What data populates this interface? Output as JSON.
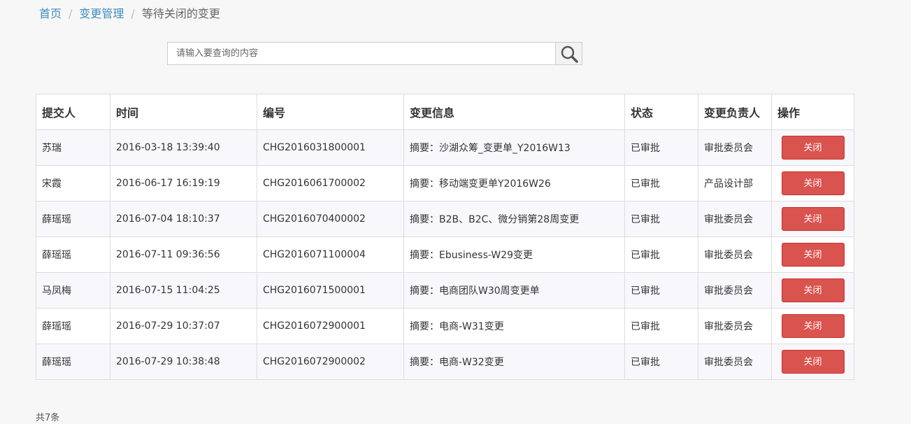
{
  "breadcrumb": {
    "home": "首页",
    "parent": "变更管理",
    "current": "等待关闭的变更",
    "separator": "/"
  },
  "search": {
    "placeholder": "请输入要查询的内容",
    "value": "",
    "button_icon": "search-icon"
  },
  "table": {
    "headers": [
      "提交人",
      "时间",
      "编号",
      "变更信息",
      "状态",
      "变更负责人",
      "操作"
    ],
    "rows": [
      {
        "submitter": "苏瑞",
        "time": "2016-03-18 13:39:40",
        "code": "CHG2016031800001",
        "info": "摘要：沙湖众筹_变更单_Y2016W13",
        "status": "已审批",
        "owner": "审批委员会",
        "action": "关闭"
      },
      {
        "submitter": "宋霞",
        "time": "2016-06-17 16:19:19",
        "code": "CHG2016061700002",
        "info": "摘要：移动端变更单Y2016W26",
        "status": "已审批",
        "owner": "产品设计部",
        "action": "关闭"
      },
      {
        "submitter": "薛瑶瑶",
        "time": "2016-07-04 18:10:37",
        "code": "CHG2016070400002",
        "info": "摘要：B2B、B2C、微分销第28周变更",
        "status": "已审批",
        "owner": "审批委员会",
        "action": "关闭"
      },
      {
        "submitter": "薛瑶瑶",
        "time": "2016-07-11 09:36:56",
        "code": "CHG2016071100004",
        "info": "摘要：Ebusiness-W29变更",
        "status": "已审批",
        "owner": "审批委员会",
        "action": "关闭"
      },
      {
        "submitter": "马凤梅",
        "time": "2016-07-15 11:04:25",
        "code": "CHG2016071500001",
        "info": "摘要：电商团队W30周变更单",
        "status": "已审批",
        "owner": "审批委员会",
        "action": "关闭"
      },
      {
        "submitter": "薛瑶瑶",
        "time": "2016-07-29 10:37:07",
        "code": "CHG2016072900001",
        "info": "摘要：电商-W31变更",
        "status": "已审批",
        "owner": "审批委员会",
        "action": "关闭"
      },
      {
        "submitter": "薛瑶瑶",
        "time": "2016-07-29 10:38:48",
        "code": "CHG2016072900002",
        "info": "摘要：电商-W32变更",
        "status": "已审批",
        "owner": "审批委员会",
        "action": "关闭"
      }
    ]
  },
  "footer": {
    "total": "共7条"
  },
  "colors": {
    "link": "#3c8dbc",
    "danger_button": "#d9534f",
    "row_stripe": "#f8f7fb"
  }
}
